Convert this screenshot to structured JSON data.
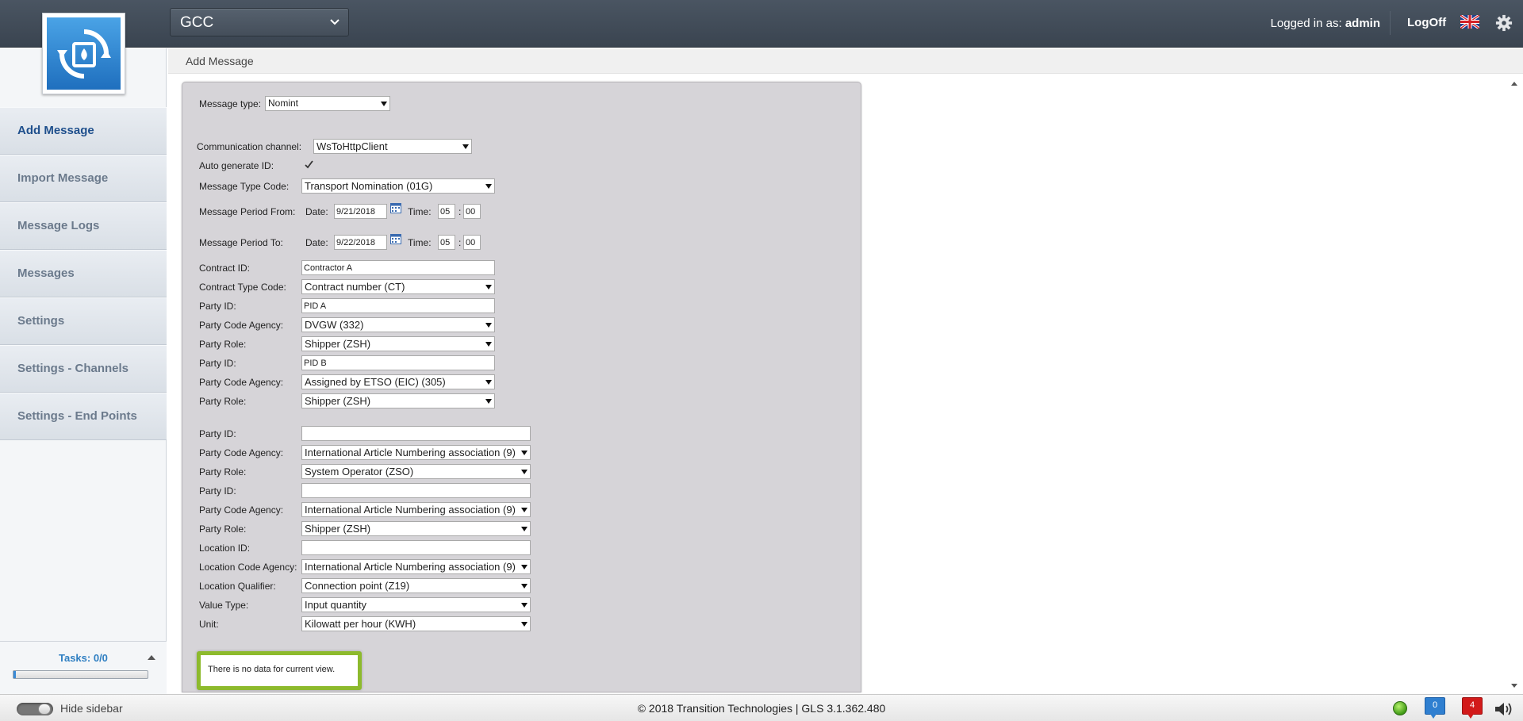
{
  "header": {
    "app_select": "GCC",
    "logged_in_prefix": "Logged in as:",
    "logged_in_user": "admin",
    "logoff": "LogOff",
    "language_flag": "uk-flag-icon"
  },
  "breadcrumb": "Add Message",
  "sidebar": {
    "items": [
      {
        "label": "Add Message",
        "active": true
      },
      {
        "label": "Import Message"
      },
      {
        "label": "Message Logs"
      },
      {
        "label": "Messages"
      },
      {
        "label": "Settings"
      },
      {
        "label": "Settings - Channels"
      },
      {
        "label": "Settings - End Points"
      }
    ],
    "tasks_label": "Tasks: 0/0"
  },
  "form": {
    "message_type": {
      "label": "Message type:",
      "value": "Nomint"
    },
    "communication_channel": {
      "label": "Communication channel:",
      "value": "WsToHttpClient"
    },
    "auto_generate_id": {
      "label": "Auto generate ID:",
      "checked": true
    },
    "message_type_code": {
      "label": "Message Type Code:",
      "value": "Transport Nomination (01G)"
    },
    "period_from": {
      "label": "Message Period From:",
      "date_label": "Date:",
      "date": "9/21/2018",
      "time_label": "Time:",
      "hour": "05",
      "sep": ":",
      "minute": "00"
    },
    "period_to": {
      "label": "Message Period To:",
      "date_label": "Date:",
      "date": "9/22/2018",
      "time_label": "Time:",
      "hour": "05",
      "sep": ":",
      "minute": "00"
    },
    "contract_id": {
      "label": "Contract ID:",
      "value": "Contractor A"
    },
    "contract_type_code": {
      "label": "Contract Type Code:",
      "value": "Contract number (CT)"
    },
    "party1": {
      "id_label": "Party ID:",
      "id": "PID A",
      "agency_label": "Party Code Agency:",
      "agency": "DVGW (332)",
      "role_label": "Party Role:",
      "role": "Shipper (ZSH)"
    },
    "party2": {
      "id_label": "Party ID:",
      "id": "PID B",
      "agency_label": "Party Code Agency:",
      "agency": "Assigned by ETSO (EIC) (305)",
      "role_label": "Party Role:",
      "role": "Shipper (ZSH)"
    },
    "party3": {
      "id_label": "Party ID:",
      "id": "",
      "agency_label": "Party Code Agency:",
      "agency": "International Article Numbering association (9)",
      "role_label": "Party Role:",
      "role": "System Operator (ZSO)"
    },
    "party4": {
      "id_label": "Party ID:",
      "id": "",
      "agency_label": "Party Code Agency:",
      "agency": "International Article Numbering association (9)",
      "role_label": "Party Role:",
      "role": "Shipper (ZSH)"
    },
    "location_id": {
      "label": "Location ID:",
      "value": ""
    },
    "location_code_agency": {
      "label": "Location Code Agency:",
      "value": "International Article Numbering association (9)"
    },
    "location_qualifier": {
      "label": "Location Qualifier:",
      "value": "Connection point (Z19)"
    },
    "value_type": {
      "label": "Value Type:",
      "value": "Input quantity"
    },
    "unit": {
      "label": "Unit:",
      "value": "Kilowatt per hour (KWH)"
    },
    "no_data_message": "There is no data for current view."
  },
  "footer": {
    "hide_sidebar": "Hide sidebar",
    "copyright": "© 2018 Transition Technologies | GLS 3.1.362.480",
    "messages_count": "0",
    "alerts_count": "4"
  },
  "colors": {
    "topbar": "#3f4955",
    "accent_blue": "#2f7fc2",
    "nodata_border": "#8dba2d",
    "alert_red": "#d21a1a"
  }
}
